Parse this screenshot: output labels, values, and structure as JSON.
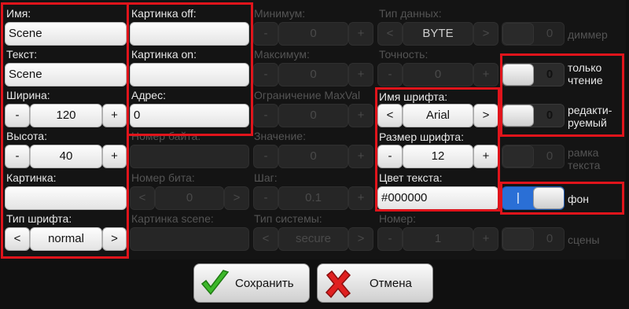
{
  "col1": {
    "name_label": "Имя:",
    "name_value": "Scene",
    "text_label": "Текст:",
    "text_value": "Scene",
    "width_label": "Ширина:",
    "width_value": "120",
    "height_label": "Высота:",
    "height_value": "40",
    "picture_label": "Картинка:",
    "picture_value": "",
    "font_type_label": "Тип шрифта:",
    "font_type_value": "normal"
  },
  "col2": {
    "pic_off_label": "Картинка off:",
    "pic_off_value": "",
    "pic_on_label": "Картинка on:",
    "pic_on_value": "",
    "address_label": "Адрес:",
    "address_value": "0",
    "byte_label": "Номер байта:",
    "byte_value": "",
    "bit_label": "Номер бита:",
    "bit_value": "0",
    "scene_pic_label": "Картинка scene:",
    "scene_pic_value": ""
  },
  "col3": {
    "min_label": "Минимум:",
    "min_value": "0",
    "max_label": "Максимум:",
    "max_value": "0",
    "maxval_label": "Ограничение MaxVal",
    "maxval_value": "0",
    "value_label": "Значение:",
    "value_value": "0",
    "step_label": "Шаг:",
    "step_value": "0.1",
    "system_label": "Тип системы:",
    "system_value": "secure"
  },
  "col4": {
    "data_type_label": "Тип данных:",
    "data_type_value": "BYTE",
    "precision_label": "Точность:",
    "precision_value": "0",
    "font_name_label": "Имя шрифта:",
    "font_name_value": "Arial",
    "font_size_label": "Размер шрифта:",
    "font_size_value": "12",
    "text_color_label": "Цвет текста:",
    "text_color_value": "#000000",
    "number_label": "Номер:",
    "number_value": "1"
  },
  "col5": {
    "dimmer_state": "0",
    "dimmer_label": "диммер",
    "readonly_state": "0",
    "readonly_label": "только\nчтение",
    "editable_state": "0",
    "editable_label": "редакти-\nруемый",
    "frame_state": "0",
    "frame_label": "рамка\nтекста",
    "bg_state": "|",
    "bg_label": "фон",
    "scenes_state": "0",
    "scenes_label": "сцены"
  },
  "controls": {
    "minus": "-",
    "plus": "+",
    "prev": "<",
    "next": ">"
  },
  "footer": {
    "save_label": "Сохранить",
    "cancel_label": "Отмена"
  },
  "colors": {
    "highlight": "#e0141b",
    "toggle_on": "#2a6fd6",
    "save_check": "#3cb82a",
    "cancel_x": "#e02020"
  }
}
